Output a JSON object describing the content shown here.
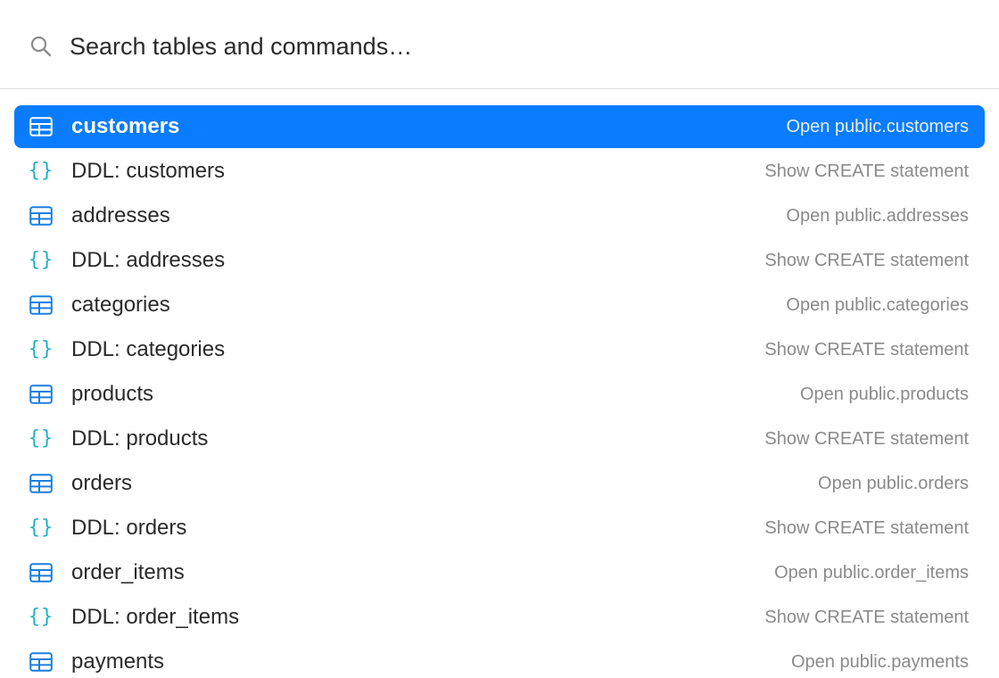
{
  "search": {
    "placeholder": "Search tables and commands…",
    "icon": "search-icon"
  },
  "colors": {
    "accent": "#0a7cff",
    "table_icon": "#1a7fe0",
    "ddl_icon": "#1fb0c4",
    "hint_text": "#8a8a8a"
  },
  "results": [
    {
      "kind": "table",
      "icon": "table-icon",
      "title": "customers",
      "hint": "Open public.customers",
      "selected": true
    },
    {
      "kind": "ddl",
      "icon": "braces-icon",
      "glyph": "{}",
      "title": "DDL: customers",
      "hint": "Show CREATE statement",
      "selected": false
    },
    {
      "kind": "table",
      "icon": "table-icon",
      "title": "addresses",
      "hint": "Open public.addresses",
      "selected": false
    },
    {
      "kind": "ddl",
      "icon": "braces-icon",
      "glyph": "{}",
      "title": "DDL: addresses",
      "hint": "Show CREATE statement",
      "selected": false
    },
    {
      "kind": "table",
      "icon": "table-icon",
      "title": "categories",
      "hint": "Open public.categories",
      "selected": false
    },
    {
      "kind": "ddl",
      "icon": "braces-icon",
      "glyph": "{}",
      "title": "DDL: categories",
      "hint": "Show CREATE statement",
      "selected": false
    },
    {
      "kind": "table",
      "icon": "table-icon",
      "title": "products",
      "hint": "Open public.products",
      "selected": false
    },
    {
      "kind": "ddl",
      "icon": "braces-icon",
      "glyph": "{}",
      "title": "DDL: products",
      "hint": "Show CREATE statement",
      "selected": false
    },
    {
      "kind": "table",
      "icon": "table-icon",
      "title": "orders",
      "hint": "Open public.orders",
      "selected": false
    },
    {
      "kind": "ddl",
      "icon": "braces-icon",
      "glyph": "{}",
      "title": "DDL: orders",
      "hint": "Show CREATE statement",
      "selected": false
    },
    {
      "kind": "table",
      "icon": "table-icon",
      "title": "order_items",
      "hint": "Open public.order_items",
      "selected": false
    },
    {
      "kind": "ddl",
      "icon": "braces-icon",
      "glyph": "{}",
      "title": "DDL: order_items",
      "hint": "Show CREATE statement",
      "selected": false
    },
    {
      "kind": "table",
      "icon": "table-icon",
      "title": "payments",
      "hint": "Open public.payments",
      "selected": false
    }
  ]
}
